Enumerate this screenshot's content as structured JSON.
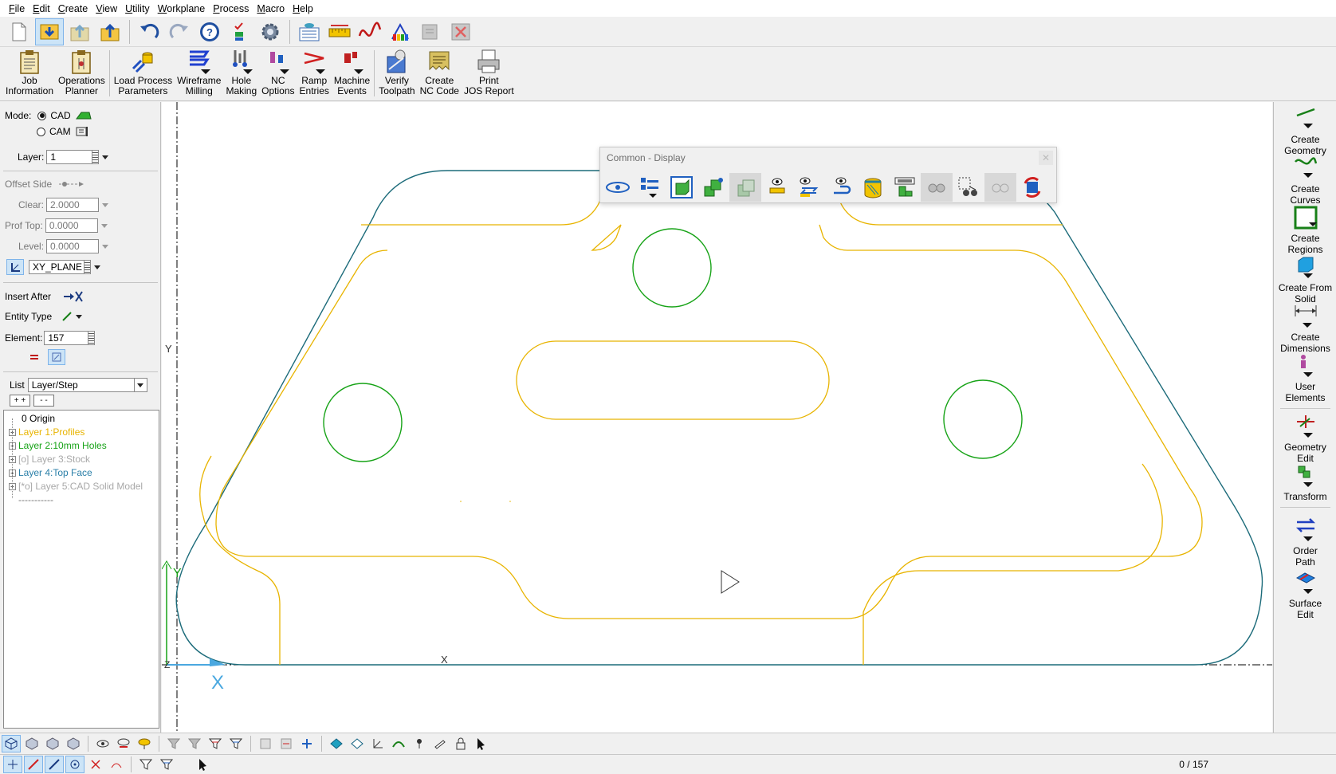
{
  "menu": [
    "File",
    "Edit",
    "Create",
    "View",
    "Utility",
    "Workplane",
    "Process",
    "Macro",
    "Help"
  ],
  "quickbar": {
    "icons": [
      "new-file-icon",
      "save-icon",
      "open-up-icon",
      "open-folder-icon",
      "undo-icon",
      "redo-icon",
      "help-icon",
      "checklist-icon",
      "settings-gear-icon",
      "view-list-icon",
      "measure-icon",
      "curve-icon",
      "rainbow-icon",
      "disabled-tool-icon",
      "cancel-icon"
    ]
  },
  "ribbon": [
    {
      "label": "Job\nInformation",
      "icon": "clipboard-icon"
    },
    {
      "label": "Operations\nPlanner",
      "icon": "planner-clipboard-icon"
    },
    {
      "label": "Load Process\nParameters",
      "icon": "load-process-icon"
    },
    {
      "label": "Wireframe\nMilling",
      "icon": "wireframe-milling-icon"
    },
    {
      "label": "Hole\nMaking",
      "icon": "hole-making-icon"
    },
    {
      "label": "NC\nOptions",
      "icon": "nc-options-icon"
    },
    {
      "label": "Ramp\nEntries",
      "icon": "ramp-entries-icon"
    },
    {
      "label": "Machine\nEvents",
      "icon": "machine-events-icon"
    },
    {
      "label": "Verify\nToolpath",
      "icon": "verify-toolpath-icon"
    },
    {
      "label": "Create\nNC Code",
      "icon": "create-nc-code-icon"
    },
    {
      "label": "Print\nJOS Report",
      "icon": "print-report-icon"
    }
  ],
  "left": {
    "mode_label": "Mode:",
    "mode_cad": "CAD",
    "mode_cam": "CAM",
    "layer_label": "Layer:",
    "layer_value": "1",
    "offset_side_label": "Offset Side",
    "clear_label": "Clear:",
    "clear_value": "2.0000",
    "prof_top_label": "Prof Top:",
    "prof_top_value": "0.0000",
    "level_label": "Level:",
    "level_value": "0.0000",
    "plane_value": "XY_PLANE",
    "insert_after_label": "Insert After",
    "entity_type_label": "Entity Type",
    "element_label": "Element:",
    "element_value": "157",
    "list_label": "List",
    "list_value": "Layer/Step",
    "expand_label": "+ +",
    "collapse_label": "- -",
    "tree": [
      {
        "label": "0 Origin",
        "color": "#000000"
      },
      {
        "label": "Layer 1:Profiles",
        "color": "#e8b400"
      },
      {
        "label": "Layer 2:10mm Holes",
        "color": "#17a317"
      },
      {
        "label": "[o] Layer 3:Stock",
        "color": "#a8a8a8"
      },
      {
        "label": "Layer 4:Top Face",
        "color": "#2a7fa8"
      },
      {
        "label": "[*o] Layer 5:CAD Solid Model",
        "color": "#a8a8a8"
      },
      {
        "label": "-----------",
        "color": "#777777"
      }
    ]
  },
  "viewport": {
    "y_axis_label": "Y",
    "x_axis_label": "X",
    "origin_y_label": "Y",
    "origin_z_label": "Z",
    "origin_x_label": "X",
    "colors": {
      "outline": "#1c6b7a",
      "profiles": "#e8b400",
      "holes": "#17a317",
      "axis": "#4aa8e0"
    }
  },
  "floatbar": {
    "title": "Common - Display",
    "close": "✕",
    "icons": [
      "display-cycle-icon",
      "layer-tree-icon",
      "shaded-solid-icon",
      "multi-solid-icon",
      "transparent-solid-icon",
      "show-entity-icon",
      "swap-visibility-icon",
      "undo-visibility-icon",
      "stock-cylinder-icon",
      "workplane-display-icon",
      "hidden-glasses-icon",
      "select-window-icon",
      "glasses-disabled-icon",
      "refresh-display-icon"
    ]
  },
  "right": [
    {
      "label": "Create\nGeometry",
      "icon": "create-geometry-icon"
    },
    {
      "label": "Create\nCurves",
      "icon": "create-curves-icon"
    },
    {
      "label": "Create\nRegions",
      "icon": "create-regions-icon"
    },
    {
      "label": "Create From\nSolid",
      "icon": "create-from-solid-icon"
    },
    {
      "label": "Create\nDimensions",
      "icon": "create-dimensions-icon"
    },
    {
      "label": "User\nElements",
      "icon": "user-elements-icon"
    },
    {
      "label": "Geometry\nEdit",
      "icon": "geometry-edit-icon"
    },
    {
      "label": "Transform",
      "icon": "transform-icon"
    },
    {
      "label": "Order\nPath",
      "icon": "order-path-icon"
    },
    {
      "label": "Surface\nEdit",
      "icon": "surface-edit-icon"
    }
  ],
  "status": {
    "count": "0 / 157"
  }
}
